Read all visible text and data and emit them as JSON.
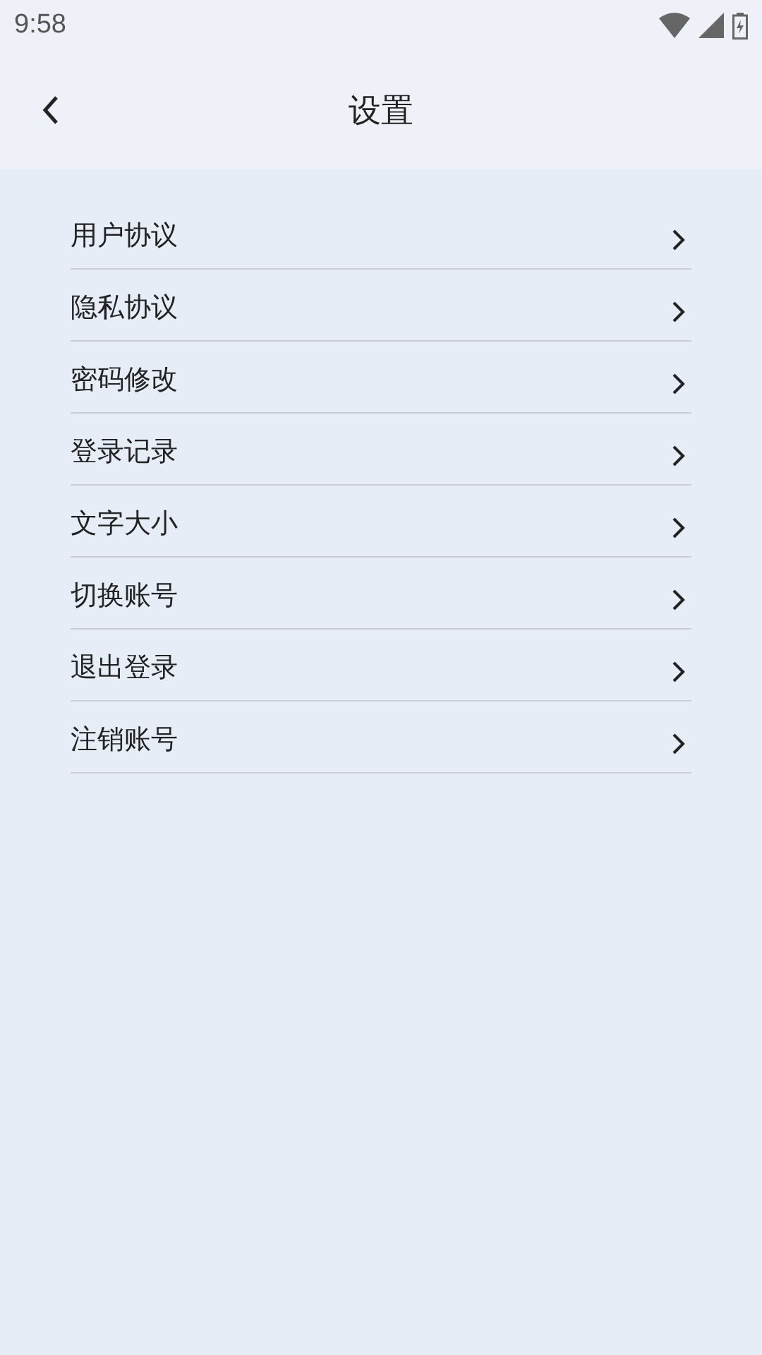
{
  "status_bar": {
    "time": "9:58"
  },
  "header": {
    "title": "设置"
  },
  "items": [
    {
      "label": "用户协议"
    },
    {
      "label": "隐私协议"
    },
    {
      "label": "密码修改"
    },
    {
      "label": "登录记录"
    },
    {
      "label": "文字大小"
    },
    {
      "label": "切换账号"
    },
    {
      "label": "退出登录"
    },
    {
      "label": "注销账号"
    }
  ]
}
